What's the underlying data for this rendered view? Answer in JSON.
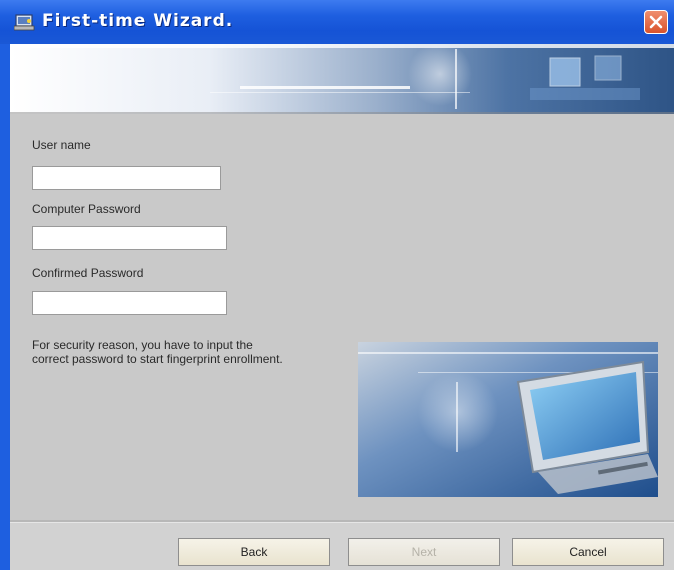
{
  "window": {
    "title": "First-time Wizard."
  },
  "form": {
    "username_label": "User name",
    "username_value": "",
    "computer_password_label": "Computer Password",
    "computer_password_value": "",
    "confirmed_password_label": "Confirmed Password",
    "confirmed_password_value": "",
    "note_line1": "For security reason, you have to input the",
    "note_line2": "correct password to start fingerprint enrollment."
  },
  "buttons": {
    "back": "Back",
    "next": "Next",
    "cancel": "Cancel"
  },
  "icons": {
    "title": "wizard-app-icon",
    "close": "close-icon"
  },
  "colors": {
    "titlebar": "#1a58d6",
    "close": "#d9532c",
    "client": "#c9c9c9"
  }
}
